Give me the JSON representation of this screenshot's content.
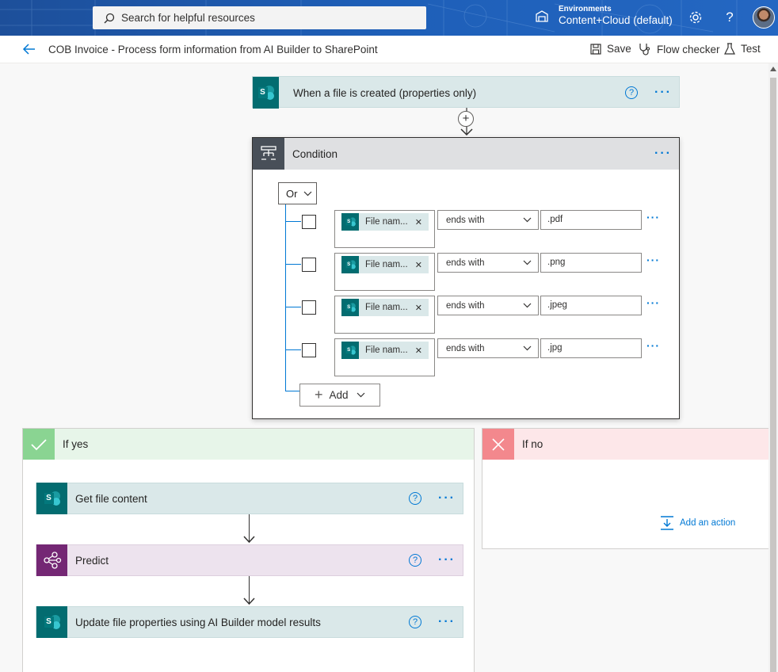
{
  "topbar": {
    "search_placeholder": "Search for helpful resources",
    "env_label": "Environments",
    "env_name": "Content+Cloud (default)",
    "icons": [
      "environment-icon",
      "settings-icon",
      "help-icon",
      "avatar"
    ]
  },
  "cmdbar": {
    "flow_title": "COB Invoice - Process form information from AI Builder to SharePoint",
    "save": "Save",
    "flow_checker": "Flow checker",
    "test": "Test"
  },
  "trigger": {
    "title": "When a file is created (properties only)",
    "help": "?",
    "more": "···"
  },
  "condition": {
    "title": "Condition",
    "more": "···",
    "group_operator": "Or",
    "rows": [
      {
        "token": "File nam...",
        "operator": "ends with",
        "value": ".pdf"
      },
      {
        "token": "File nam...",
        "operator": "ends with",
        "value": ".png"
      },
      {
        "token": "File nam...",
        "operator": "ends with",
        "value": ".jpeg"
      },
      {
        "token": "File nam...",
        "operator": "ends with",
        "value": ".jpg"
      }
    ],
    "add_label": "Add"
  },
  "if_yes": {
    "title": "If yes",
    "actions": [
      {
        "title": "Get file content",
        "connector": "SharePoint"
      },
      {
        "title": "Predict",
        "connector": "AI Builder"
      },
      {
        "title": "Update file properties using AI Builder model results",
        "connector": "SharePoint"
      }
    ]
  },
  "if_no": {
    "title": "If no",
    "add_action": "Add an action"
  },
  "colors": {
    "topbar": "#1e5fb8",
    "accent": "#0078d4",
    "sharepoint": "#036c70",
    "ai_builder": "#742774",
    "yes_green": "#8ad492",
    "no_red": "#f3888d"
  }
}
